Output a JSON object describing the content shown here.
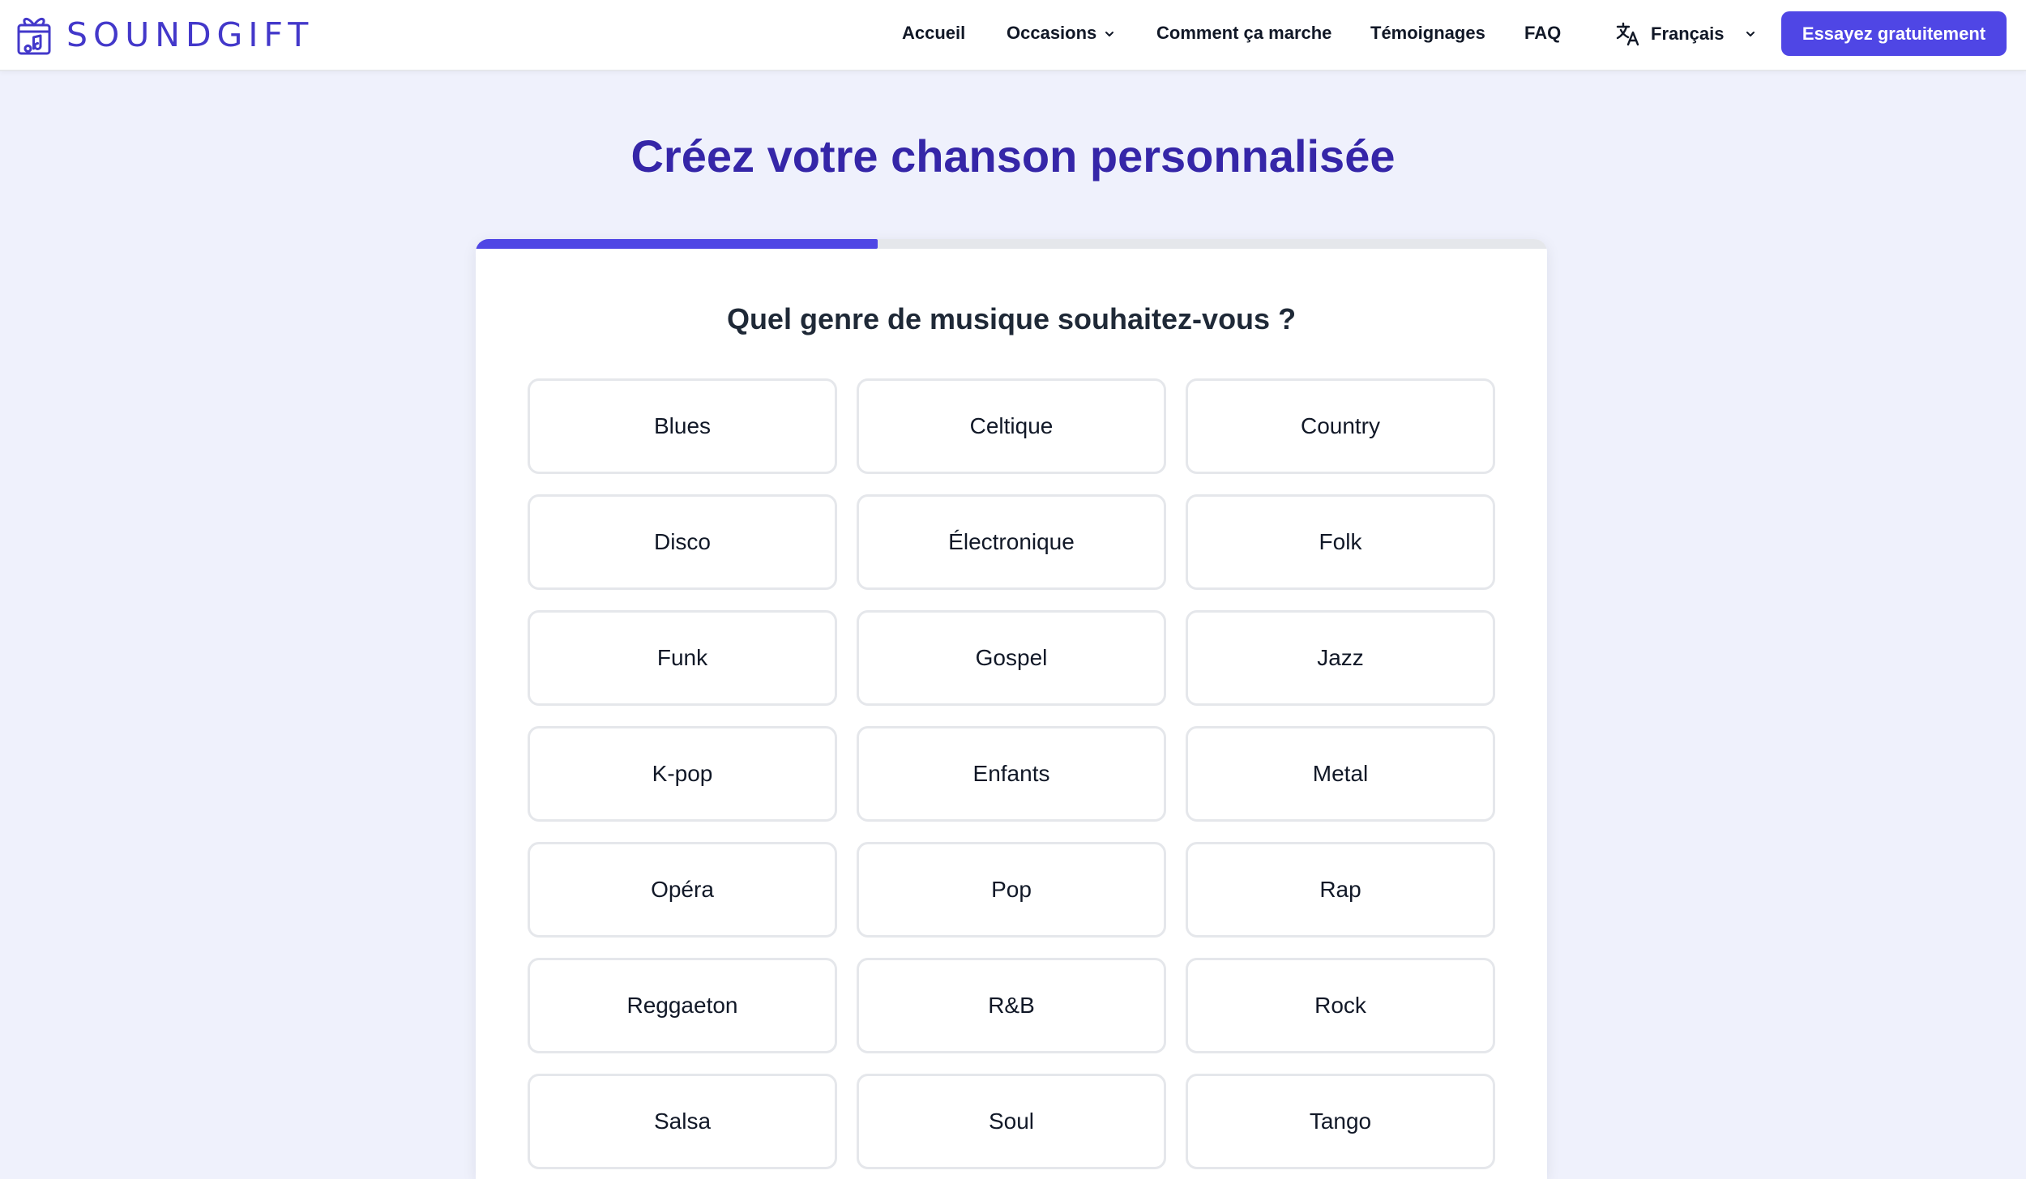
{
  "brand": {
    "name": "SOUNDGIFT",
    "accent_color": "#4f46e5",
    "logo_icon": "gift-music-note-icon"
  },
  "nav": {
    "items": [
      {
        "label": "Accueil"
      },
      {
        "label": "Occasions",
        "has_dropdown": true
      },
      {
        "label": "Comment ça marche"
      },
      {
        "label": "Témoignages"
      },
      {
        "label": "FAQ"
      }
    ],
    "language": {
      "label": "Français",
      "icon": "translate-icon"
    },
    "cta_label": "Essayez gratuitement"
  },
  "page": {
    "title": "Créez votre chanson personnalisée"
  },
  "wizard": {
    "progress": 0.375,
    "question": "Quel genre de musique souhaitez-vous ?",
    "genres": [
      "Blues",
      "Celtique",
      "Country",
      "Disco",
      "Électronique",
      "Folk",
      "Funk",
      "Gospel",
      "Jazz",
      "K-pop",
      "Enfants",
      "Metal",
      "Opéra",
      "Pop",
      "Rap",
      "Reggaeton",
      "R&B",
      "Rock",
      "Salsa",
      "Soul",
      "Tango"
    ]
  }
}
